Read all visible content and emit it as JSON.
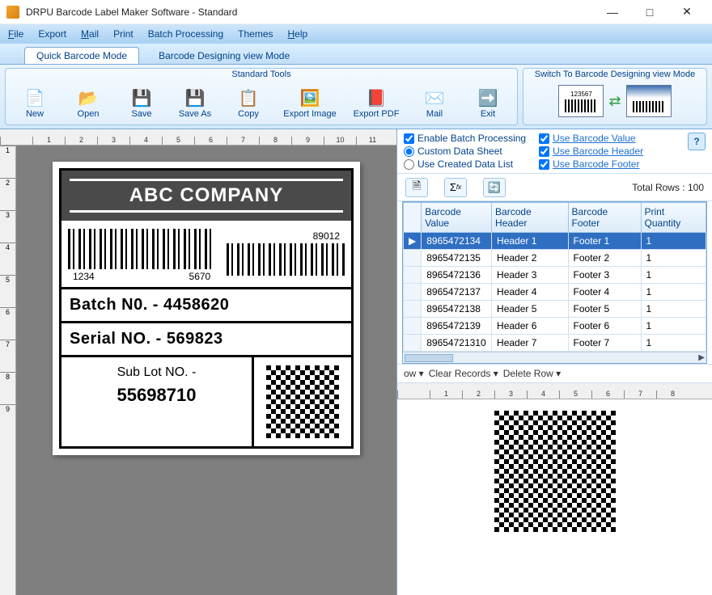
{
  "window": {
    "title": "DRPU Barcode Label Maker Software - Standard"
  },
  "menu": {
    "file": "File",
    "export": "Export",
    "mail": "Mail",
    "print": "Print",
    "batch": "Batch Processing",
    "themes": "Themes",
    "help": "Help"
  },
  "modes": {
    "quick": "Quick Barcode Mode",
    "design": "Barcode Designing view Mode"
  },
  "tools": {
    "hdr": "Standard Tools",
    "new": "New",
    "open": "Open",
    "save": "Save",
    "saveas": "Save As",
    "copy": "Copy",
    "exportimg": "Export Image",
    "exportpdf": "Export PDF",
    "mail": "Mail",
    "exit": "Exit",
    "switchhdr": "Switch To Barcode Designing view Mode",
    "switchnum": "123567"
  },
  "label": {
    "company": "ABC COMPANY",
    "bc1_a": "1234",
    "bc1_b": "5670",
    "bc2": "89012",
    "batch": "Batch N0. - 4458620",
    "serial": "Serial NO. - 569823",
    "sublot_l": "Sub Lot NO. -",
    "sublot_v": "55698710"
  },
  "opts": {
    "enable": "Enable Batch Processing",
    "custom": "Custom Data Sheet",
    "created": "Use Created Data List",
    "usebv": "Use Barcode Value",
    "usebh": "Use Barcode Header",
    "usebf": "Use Barcode Footer"
  },
  "totalrows": "Total Rows : 100",
  "cols": {
    "bv": "Barcode Value",
    "bh": "Barcode Header",
    "bf": "Barcode Footer",
    "pq": "Print Quantity"
  },
  "rows": [
    {
      "v": "8965472134",
      "h": "Header 1",
      "f": "Footer 1",
      "q": "1"
    },
    {
      "v": "8965472135",
      "h": "Header 2",
      "f": "Footer 2",
      "q": "1"
    },
    {
      "v": "8965472136",
      "h": "Header 3",
      "f": "Footer 3",
      "q": "1"
    },
    {
      "v": "8965472137",
      "h": "Header 4",
      "f": "Footer 4",
      "q": "1"
    },
    {
      "v": "8965472138",
      "h": "Header 5",
      "f": "Footer 5",
      "q": "1"
    },
    {
      "v": "8965472139",
      "h": "Header 6",
      "f": "Footer 6",
      "q": "1"
    },
    {
      "v": "89654721310",
      "h": "Header 7",
      "f": "Footer 7",
      "q": "1"
    }
  ],
  "rowops": {
    "ow": "ow ▾",
    "clear": "Clear Records ▾",
    "del": "Delete Row ▾"
  },
  "ruler": [
    "1",
    "2",
    "3",
    "4",
    "5",
    "6",
    "7",
    "8",
    "9",
    "10",
    "11"
  ],
  "rulerR": [
    "1",
    "2",
    "3",
    "4",
    "5",
    "6",
    "7",
    "8"
  ]
}
